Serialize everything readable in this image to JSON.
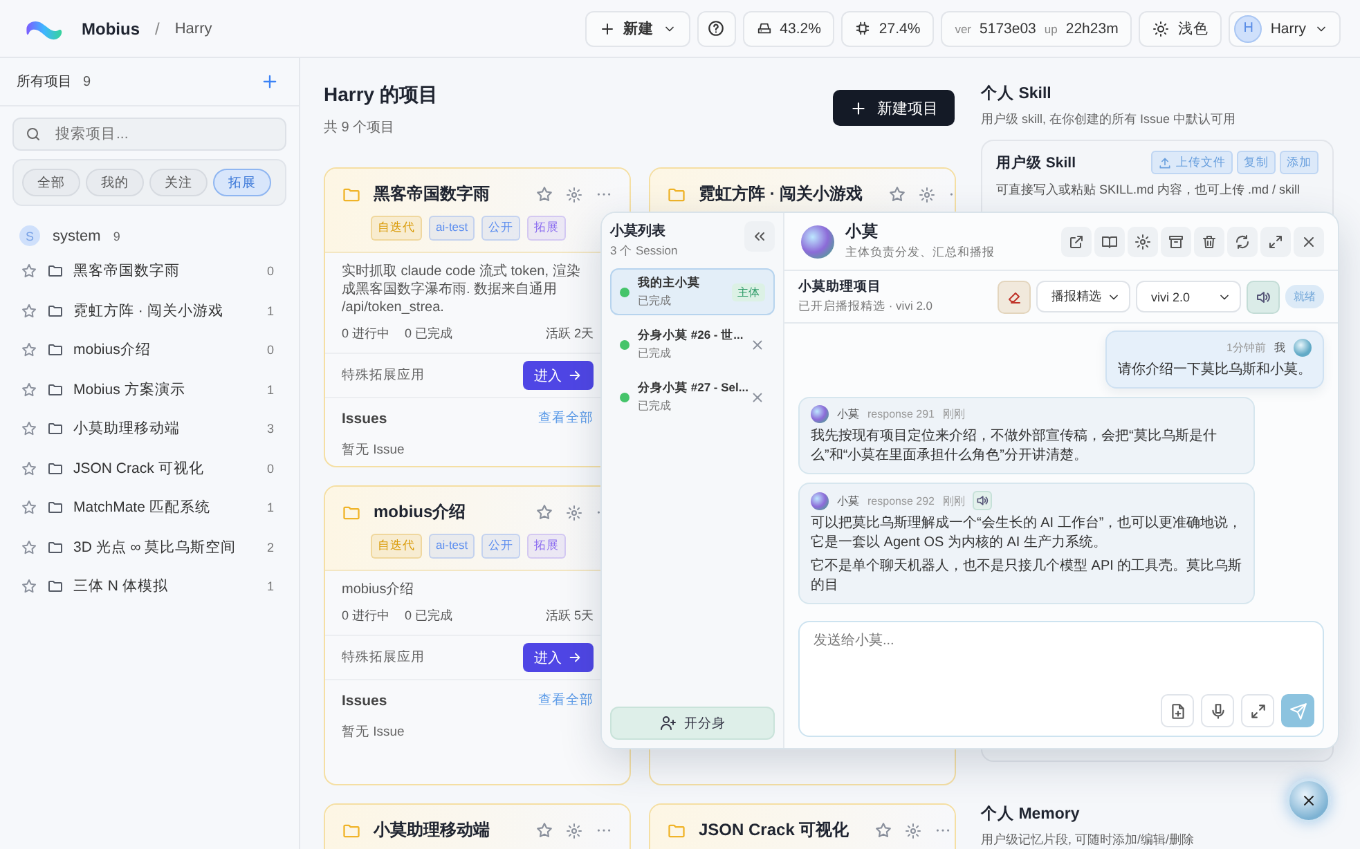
{
  "topbar": {
    "app_name": "Mobius",
    "separator": "/",
    "breadcrumb": "Harry",
    "new_button": "新建",
    "disk_usage": "43.2%",
    "cpu_usage": "27.4%",
    "version_label": "ver",
    "version": "5173e03",
    "uptime_label": "up",
    "uptime": "22h23m",
    "theme_button": "浅色",
    "user": {
      "initial": "H",
      "name": "Harry"
    }
  },
  "sidebar": {
    "title": "所有项目",
    "count": "9",
    "search": {
      "placeholder": "搜索项目..."
    },
    "filters": [
      {
        "label": "全部",
        "selected": false
      },
      {
        "label": "我的",
        "selected": false
      },
      {
        "label": "关注",
        "selected": false
      },
      {
        "label": "拓展",
        "selected": true
      }
    ],
    "group": {
      "initial": "S",
      "name": "system",
      "count": "9"
    },
    "items": [
      {
        "name": "黑客帝国数字雨",
        "count": "0"
      },
      {
        "name": "霓虹方阵 · 闯关小游戏",
        "count": "1"
      },
      {
        "name": "mobius介绍",
        "count": "0"
      },
      {
        "name": "Mobius 方案演示",
        "count": "1"
      },
      {
        "name": "小莫助理移动端",
        "count": "3"
      },
      {
        "name": "JSON Crack 可视化",
        "count": "0"
      },
      {
        "name": "MatchMate 匹配系统",
        "count": "1"
      },
      {
        "name": "3D 光点 ∞ 莫比乌斯空间",
        "count": "2"
      },
      {
        "name": "三体 N 体模拟",
        "count": "1"
      }
    ]
  },
  "main": {
    "title": "Harry 的项目",
    "subtitle": "共 9 个项目",
    "new_project_button": "新建项目",
    "cards": [
      {
        "kind": "full",
        "title": "黑客帝国数字雨",
        "tags": [
          {
            "label": "自迭代",
            "color": "#d99a06"
          },
          {
            "label": "ai-test",
            "color": "#5b8def"
          },
          {
            "label": "公开",
            "color": "#5b8def"
          },
          {
            "label": "拓展",
            "color": "#8b6cf0"
          }
        ],
        "description": "实时抓取 claude code 流式 token, 渲染成黑客国数字瀑布雨. 数据来自通用 /api/token_strea.",
        "running": "0 进行中",
        "done": "0 已完成",
        "activity": "活跃 2天",
        "app_label": "特殊拓展应用",
        "enter_button": "进入",
        "issues_title": "Issues",
        "view_all": "查看全部",
        "issues_empty": "暂无 Issue"
      },
      {
        "kind": "header",
        "title": "霓虹方阵 · 闯关小游戏"
      },
      {
        "kind": "full",
        "title": "mobius介绍",
        "tags": [
          {
            "label": "自迭代",
            "color": "#d99a06"
          },
          {
            "label": "ai-test",
            "color": "#5b8def"
          },
          {
            "label": "公开",
            "color": "#5b8def"
          },
          {
            "label": "拓展",
            "color": "#8b6cf0"
          }
        ],
        "description": "mobius介绍",
        "running": "0 进行中",
        "done": "0 已完成",
        "activity": "活跃 5天",
        "app_label": "特殊拓展应用",
        "enter_button": "进入",
        "issues_title": "Issues",
        "view_all": "查看全部",
        "issues_empty": "暂无 Issue"
      },
      {
        "kind": "blank"
      },
      {
        "kind": "header",
        "title": "小莫助理移动端"
      },
      {
        "kind": "header",
        "title": "JSON Crack 可视化"
      }
    ]
  },
  "right_panel": {
    "skill": {
      "title": "个人 Skill",
      "subtitle": "用户级 skill, 在你创建的所有 Issue 中默认可用",
      "card_title": "用户级 Skill",
      "upload_button": "上传文件",
      "copy_button": "复制",
      "add_button": "添加",
      "hint": "可直接写入或粘贴 SKILL.md 内容，也可上传 .md / skill"
    },
    "memory": {
      "title": "个人 Memory",
      "subtitle": "用户级记忆片段, 可随时添加/编辑/删除"
    }
  },
  "chat": {
    "list": {
      "title": "小莫列表",
      "count": "3 个 Session",
      "branch_button": "开分身",
      "sessions": [
        {
          "name": "我的主小莫",
          "status": "已完成",
          "kind": "main",
          "badge": "主体",
          "selected": true
        },
        {
          "name": "分身小莫 #26 - 世...",
          "status": "已完成",
          "kind": "branch",
          "selected": false
        },
        {
          "name": "分身小莫 #27 - Sel...",
          "status": "已完成",
          "kind": "branch",
          "selected": false
        }
      ]
    },
    "header": {
      "name": "小莫",
      "role": "主体负责分发、汇总和播报"
    },
    "project": {
      "title": "小莫助理项目",
      "status": "已开启播报精选 · vivi 2.0",
      "mode": "播报精选",
      "voice": "vivi 2.0",
      "state": "就绪"
    },
    "messages": [
      {
        "kind": "user",
        "time": "1分钟前",
        "author": "我",
        "paragraphs": [
          "请你介绍一下莫比乌斯和小莫。"
        ]
      },
      {
        "kind": "assistant",
        "author": "小莫",
        "response": "response 291",
        "time": "刚刚",
        "speaker": false,
        "paragraphs": [
          "我先按现有项目定位来介绍，不做外部宣传稿，会把“莫比乌斯是什么”和“小莫在里面承担什么角色”分开讲清楚。"
        ]
      },
      {
        "kind": "assistant",
        "author": "小莫",
        "response": "response 292",
        "time": "刚刚",
        "speaker": true,
        "paragraphs": [
          "可以把莫比乌斯理解成一个“会生长的 AI 工作台”，也可以更准确地说，它是一套以 Agent OS 为内核的 AI 生产力系统。",
          "它不是单个聊天机器人，也不是只接几个模型 API 的工具壳。莫比乌斯的目"
        ]
      }
    ],
    "input": {
      "placeholder": "发送给小莫..."
    }
  }
}
